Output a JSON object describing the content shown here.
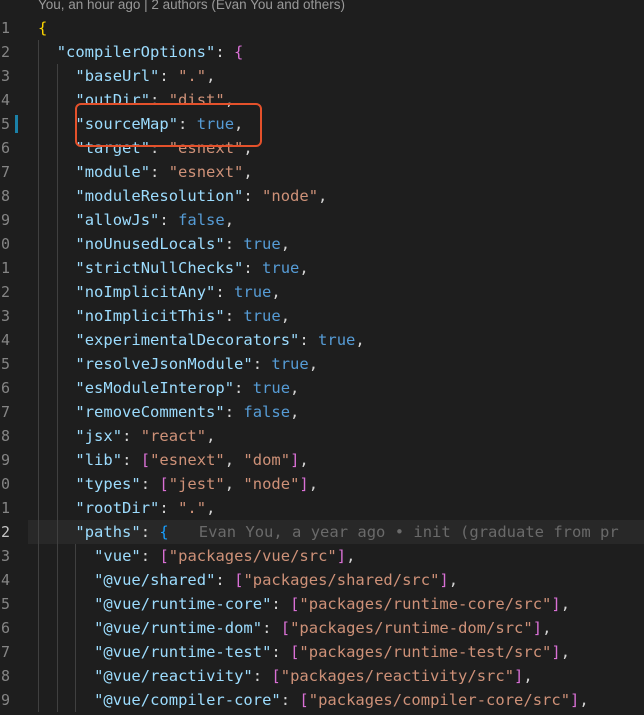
{
  "codelens": "You, an hour ago | 2 authors (Evan You and others)",
  "blame": "Evan You, a year ago • init (graduate from pr",
  "colors": {
    "background": "#1e1e1e",
    "key": "#9cdcfe",
    "string": "#ce9178",
    "boolean": "#569cd6",
    "highlight": "#e4512b"
  },
  "lines": [
    {
      "n": "1",
      "open": "{"
    },
    {
      "n": "2",
      "key": "\"compilerOptions\"",
      "open": "{"
    },
    {
      "n": "3",
      "key": "\"baseUrl\"",
      "str": "\".\""
    },
    {
      "n": "4",
      "key": "\"outDir\"",
      "str": "\"dist\""
    },
    {
      "n": "5",
      "key": "\"sourceMap\"",
      "bool": "true"
    },
    {
      "n": "6",
      "key": "\"target\"",
      "str": "\"esnext\""
    },
    {
      "n": "7",
      "key": "\"module\"",
      "str": "\"esnext\""
    },
    {
      "n": "8",
      "key": "\"moduleResolution\"",
      "str": "\"node\""
    },
    {
      "n": "9",
      "key": "\"allowJs\"",
      "bool": "false"
    },
    {
      "n": "0",
      "key": "\"noUnusedLocals\"",
      "bool": "true"
    },
    {
      "n": "1",
      "key": "\"strictNullChecks\"",
      "bool": "true"
    },
    {
      "n": "2",
      "key": "\"noImplicitAny\"",
      "bool": "true"
    },
    {
      "n": "3",
      "key": "\"noImplicitThis\"",
      "bool": "true"
    },
    {
      "n": "4",
      "key": "\"experimentalDecorators\"",
      "bool": "true"
    },
    {
      "n": "5",
      "key": "\"resolveJsonModule\"",
      "bool": "true"
    },
    {
      "n": "6",
      "key": "\"esModuleInterop\"",
      "bool": "true"
    },
    {
      "n": "7",
      "key": "\"removeComments\"",
      "bool": "false"
    },
    {
      "n": "8",
      "key": "\"jsx\"",
      "str": "\"react\""
    },
    {
      "n": "9",
      "key": "\"lib\"",
      "arr": [
        "\"esnext\"",
        "\"dom\""
      ]
    },
    {
      "n": "0",
      "key": "\"types\"",
      "arr": [
        "\"jest\"",
        "\"node\""
      ]
    },
    {
      "n": "1",
      "key": "\"rootDir\"",
      "str": "\".\""
    },
    {
      "n": "2",
      "key": "\"paths\"",
      "open": "{"
    },
    {
      "n": "3",
      "key": "\"vue\"",
      "arr": [
        "\"packages/vue/src\""
      ]
    },
    {
      "n": "4",
      "key": "\"@vue/shared\"",
      "arr": [
        "\"packages/shared/src\""
      ]
    },
    {
      "n": "5",
      "key": "\"@vue/runtime-core\"",
      "arr": [
        "\"packages/runtime-core/src\""
      ]
    },
    {
      "n": "6",
      "key": "\"@vue/runtime-dom\"",
      "arr": [
        "\"packages/runtime-dom/src\""
      ]
    },
    {
      "n": "7",
      "key": "\"@vue/runtime-test\"",
      "arr": [
        "\"packages/runtime-test/src\""
      ]
    },
    {
      "n": "8",
      "key": "\"@vue/reactivity\"",
      "arr": [
        "\"packages/reactivity/src\""
      ]
    },
    {
      "n": "9",
      "key": "\"@vue/compiler-core\"",
      "arr": [
        "\"packages/compiler-core/src\""
      ]
    }
  ]
}
